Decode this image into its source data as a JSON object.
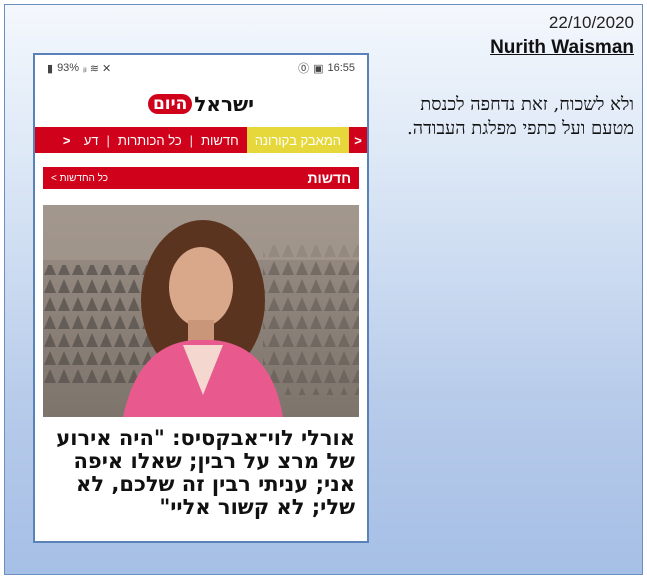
{
  "slide": {
    "date": "22/10/2020",
    "author": "Nurith Waisman",
    "caption_lines": [
      "ולא לשכוח, זאת נדחפה לכנסת",
      "מטעם ועל כתפי מפלגת העבודה."
    ]
  },
  "phone": {
    "statusbar": {
      "battery": "93%",
      "signal_icons": "ᵢₗ ≋ ✕",
      "time": "16:55"
    },
    "logo": {
      "text": "ישראל",
      "badge": "היום"
    },
    "nav": {
      "items": [
        "המאבק בקורונה",
        "חדשות",
        "כל הכותרות",
        "דע"
      ],
      "active_index": 0,
      "left_arrow": "<",
      "right_arrow": "<"
    },
    "section": {
      "title": "חדשות",
      "link": "כל החדשות >"
    },
    "headline": "אורלי לוי־אבקסיס: \"היה אירוע של מרצ על רבין; שאלו איפה אני; עניתי רבין זה שלכם, לא שלי; לא קשור אליי\""
  },
  "colors": {
    "brand_red": "#d0021b",
    "active_tab": "#e6d83a"
  }
}
